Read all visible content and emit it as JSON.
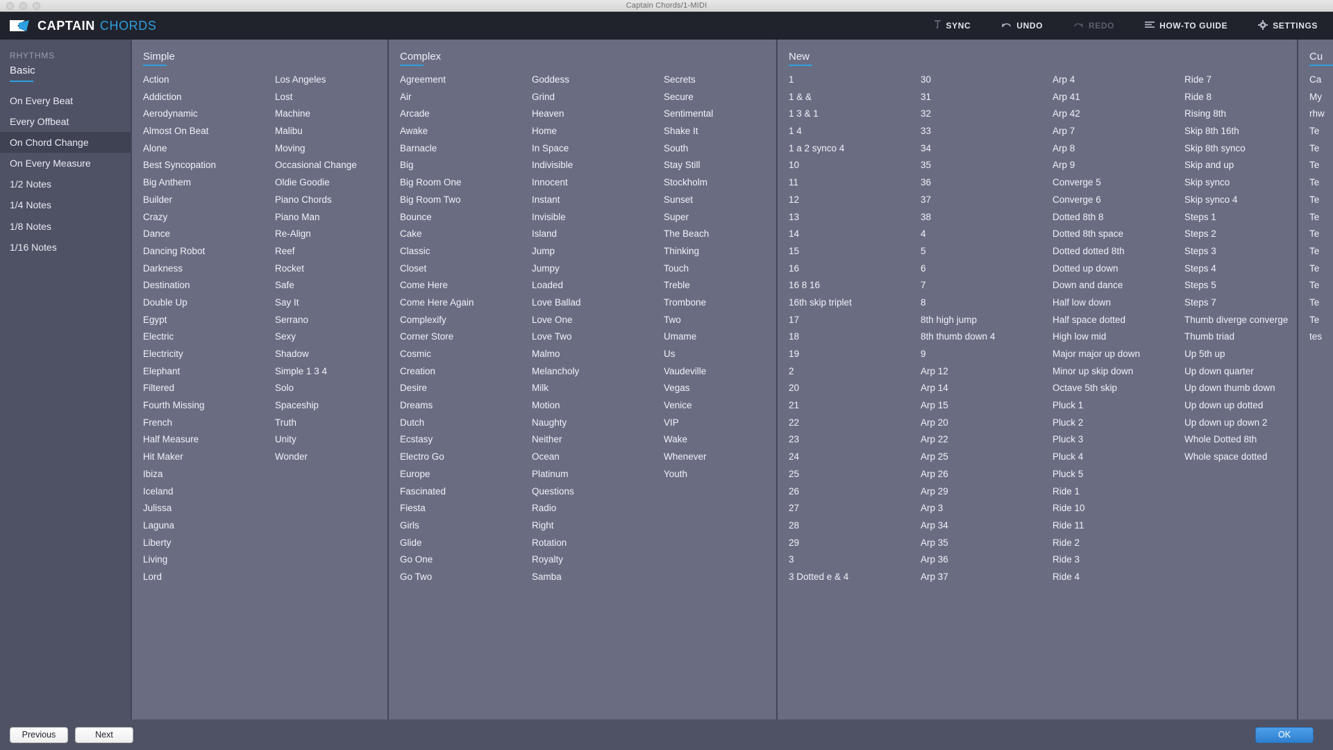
{
  "window": {
    "title": "Captain Chords/1-MIDI"
  },
  "header": {
    "brand_primary": "CAPTAIN",
    "brand_secondary": "CHORDS",
    "accent_color": "#2e9fe0",
    "menu": [
      {
        "label": "SYNC",
        "icon": "sync-icon",
        "disabled": false
      },
      {
        "label": "UNDO",
        "icon": "undo-arrow-icon",
        "disabled": false
      },
      {
        "label": "REDO",
        "icon": "redo-arrow-icon",
        "disabled": true
      },
      {
        "label": "HOW-TO GUIDE",
        "icon": "list-lines-icon",
        "disabled": false
      },
      {
        "label": "SETTINGS",
        "icon": "gear-icon",
        "disabled": false
      }
    ]
  },
  "sidebar": {
    "section_label": "RHYTHMS",
    "tab": "Basic",
    "selected": "On Chord Change",
    "items": [
      "On Every Beat",
      "Every Offbeat",
      "On Chord Change",
      "On Every Measure",
      "1/2 Notes",
      "1/4 Notes",
      "1/8 Notes",
      "1/16 Notes"
    ]
  },
  "panes": [
    {
      "title": "Simple",
      "columns": [
        [
          "Action",
          "Addiction",
          "Aerodynamic",
          "Almost On Beat",
          "Alone",
          "Best Syncopation",
          "Big Anthem",
          "Builder",
          "Crazy",
          "Dance",
          "Dancing Robot",
          "Darkness",
          "Destination",
          "Double Up",
          "Egypt",
          "Electric",
          "Electricity",
          "Elephant",
          "Filtered",
          "Fourth Missing",
          "French",
          "Half Measure",
          "Hit Maker",
          "Ibiza",
          "Iceland",
          "Julissa",
          "Laguna",
          "Liberty",
          "Living",
          "Lord"
        ],
        [
          "Los Angeles",
          "Lost",
          "Machine",
          "Malibu",
          "Moving",
          "Occasional Change",
          "Oldie Goodie",
          "Piano Chords",
          "Piano Man",
          "Re-Align",
          "Reef",
          "Rocket",
          "Safe",
          "Say It",
          "Serrano",
          "Sexy",
          "Shadow",
          "Simple 1 3 4",
          "Solo",
          "Spaceship",
          "Truth",
          "Unity",
          "Wonder"
        ]
      ]
    },
    {
      "title": "Complex",
      "columns": [
        [
          "Agreement",
          "Air",
          "Arcade",
          "Awake",
          "Barnacle",
          "Big",
          "Big Room One",
          "Big Room Two",
          "Bounce",
          "Cake",
          "Classic",
          "Closet",
          "Come Here",
          "Come Here Again",
          "Complexify",
          "Corner Store",
          "Cosmic",
          "Creation",
          "Desire",
          "Dreams",
          "Dutch",
          "Ecstasy",
          "Electro Go",
          "Europe",
          "Fascinated",
          "Fiesta",
          "Girls",
          "Glide",
          "Go One",
          "Go Two"
        ],
        [
          "Goddess",
          "Grind",
          "Heaven",
          "Home",
          "In Space",
          "Indivisible",
          "Innocent",
          "Instant",
          "Invisible",
          "Island",
          "Jump",
          "Jumpy",
          "Loaded",
          "Love Ballad",
          "Love One",
          "Love Two",
          "Malmo",
          "Melancholy",
          "Milk",
          "Motion",
          "Naughty",
          "Neither",
          "Ocean",
          "Platinum",
          "Questions",
          "Radio",
          "Right",
          "Rotation",
          "Royalty",
          "Samba"
        ],
        [
          "Secrets",
          "Secure",
          "Sentimental",
          "Shake It",
          "South",
          "Stay Still",
          "Stockholm",
          "Sunset",
          "Super",
          "The Beach",
          "Thinking",
          "Touch",
          "Treble",
          "Trombone",
          "Two",
          "Umame",
          "Us",
          "Vaudeville",
          "Vegas",
          "Venice",
          "VIP",
          "Wake",
          "Whenever",
          "Youth"
        ]
      ]
    },
    {
      "title": "New",
      "columns": [
        [
          "1",
          "1 & &",
          "1 3 & 1",
          "1 4",
          "1 a 2 synco 4",
          "10",
          "11",
          "12",
          "13",
          "14",
          "15",
          "16",
          "16 8 16",
          "16th skip triplet",
          "17",
          "18",
          "19",
          "2",
          "20",
          "21",
          "22",
          "23",
          "24",
          "25",
          "26",
          "27",
          "28",
          "29",
          "3",
          "3 Dotted e & 4"
        ],
        [
          "30",
          "31",
          "32",
          "33",
          "34",
          "35",
          "36",
          "37",
          "38",
          "4",
          "5",
          "6",
          "7",
          "8",
          "8th high jump",
          "8th thumb down 4",
          "9",
          "Arp 12",
          "Arp 14",
          "Arp 15",
          "Arp 20",
          "Arp 22",
          "Arp 25",
          "Arp 26",
          "Arp 29",
          "Arp 3",
          "Arp 34",
          "Arp 35",
          "Arp 36",
          "Arp 37"
        ],
        [
          "Arp 4",
          "Arp 41",
          "Arp 42",
          "Arp 7",
          "Arp 8",
          "Arp 9",
          "Converge 5",
          "Converge 6",
          "Dotted 8th 8",
          "Dotted 8th space",
          "Dotted dotted 8th",
          "Dotted up down",
          "Down and dance",
          "Half low down",
          "Half space dotted",
          "High low mid",
          "Major major up down",
          "Minor up skip down",
          "Octave 5th skip",
          "Pluck 1",
          "Pluck 2",
          "Pluck 3",
          "Pluck 4",
          "Pluck 5",
          "Ride 1",
          "Ride 10",
          "Ride 11",
          "Ride 2",
          "Ride 3",
          "Ride 4"
        ],
        [
          "Ride 7",
          "Ride 8",
          "Rising 8th",
          "Skip 8th 16th",
          "Skip 8th synco",
          "Skip and up",
          "Skip synco",
          "Skip synco 4",
          "Steps 1",
          "Steps 2",
          "Steps 3",
          "Steps 4",
          "Steps 5",
          "Steps 7",
          "Thumb diverge converge",
          "Thumb triad",
          "Up 5th up",
          "Up down quarter",
          "Up down thumb down",
          "Up down up dotted",
          "Up down up down 2",
          "Whole Dotted 8th",
          "Whole space dotted"
        ]
      ]
    },
    {
      "title": "Cu",
      "columns": [
        [
          "Ca",
          "My",
          "rhw",
          "Te",
          "Te",
          "Te",
          "Te",
          "Te",
          "Te",
          "Te",
          "Te",
          "Te",
          "Te",
          "Te",
          "Te",
          "tes"
        ]
      ]
    }
  ],
  "footer": {
    "previous_label": "Previous",
    "next_label": "Next",
    "ok_label": "OK"
  }
}
